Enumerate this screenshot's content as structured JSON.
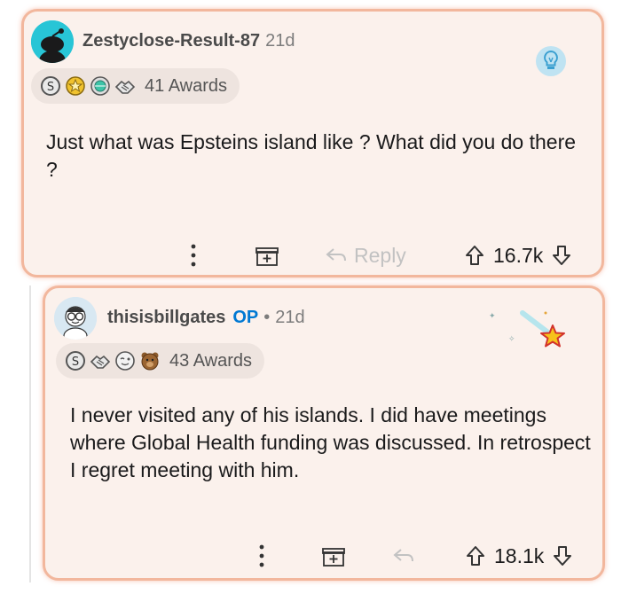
{
  "comments": [
    {
      "username": "Zestyclose-Result-87",
      "age": "21d",
      "awards_count_label": "41 Awards",
      "award_icons": [
        "silver-award-icon",
        "gold-star-award-icon",
        "globe-award-icon",
        "handshake-award-icon"
      ],
      "body": "Just what was Epsteins island like ? What did you do there ?",
      "reply_label": "Reply",
      "score": "16.7k",
      "corner_icon": "lightbulb-icon"
    },
    {
      "username": "thisisbillgates",
      "op_label": "OP",
      "separator": "•",
      "age": "21d",
      "awards_count_label": "43 Awards",
      "award_icons": [
        "silver-award-icon",
        "handshake-award-icon",
        "wink-face-award-icon",
        "bear-award-icon"
      ],
      "body": "I never visited any of his islands. I did have meetings where Global Health funding was discussed. In retrospect I regret meeting with him.",
      "score": "18.1k",
      "corner_icon": "shooting-star-icon"
    }
  ],
  "colors": {
    "card_background": "#fbf1ec",
    "card_border": "#f2b79d",
    "op_blue": "#0079d3",
    "muted": "#7c7c7c"
  }
}
